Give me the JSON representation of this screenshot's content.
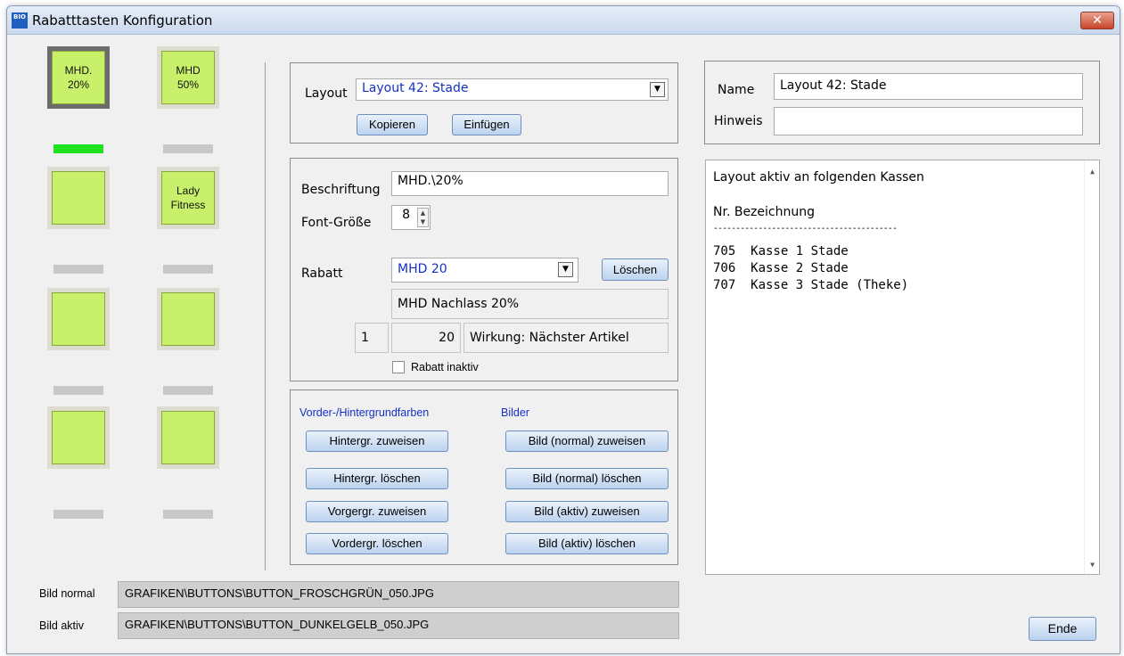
{
  "window": {
    "title": "Rabatttasten Konfiguration",
    "icon_text": "BIO",
    "close_label": "✕"
  },
  "keys": [
    {
      "label": "MHD.\n20%",
      "indicator_active": true,
      "selected": true
    },
    {
      "label": "MHD\n50%",
      "indicator_active": false,
      "selected": false
    },
    {
      "label": "",
      "indicator_active": false,
      "selected": false
    },
    {
      "label": "Lady\nFitness",
      "indicator_active": false,
      "selected": false
    },
    {
      "label": "",
      "indicator_active": false,
      "selected": false
    },
    {
      "label": "",
      "indicator_active": false,
      "selected": false
    },
    {
      "label": "",
      "indicator_active": false,
      "selected": false
    },
    {
      "label": "",
      "indicator_active": false,
      "selected": false
    }
  ],
  "layout_box": {
    "label": "Layout",
    "selected": "Layout 42: Stade",
    "copy_button": "Kopieren",
    "paste_button": "Einfügen"
  },
  "key_box": {
    "caption_label": "Beschriftung",
    "caption_value": "MHD.\\20%",
    "font_size_label": "Font-Größe",
    "font_size_value": "8",
    "discount_label": "Rabatt",
    "discount_selected": "MHD 20",
    "delete_button": "Löschen",
    "discount_description": "MHD Nachlass 20%",
    "discount_number": "1",
    "discount_percent": "20",
    "effect": "Wirkung: Nächster Artikel",
    "inactive_label": "Rabatt inaktiv",
    "inactive_checked": false
  },
  "colors_box": {
    "colors_heading": "Vorder-/Hintergrundfarben",
    "images_heading": "Bilder",
    "buttons_left": [
      "Hintergr. zuweisen",
      "Hintergr. löschen",
      "Vorgergr. zuweisen",
      "Vordergr. löschen"
    ],
    "buttons_right": [
      "Bild  (normal) zuweisen",
      "Bild (normal) löschen",
      "Bild (aktiv) zuweisen",
      "Bild  (aktiv) löschen"
    ]
  },
  "info_box": {
    "name_label": "Name",
    "name_value": "Layout 42: Stade",
    "note_label": "Hinweis",
    "note_value": ""
  },
  "registers": {
    "heading": "Layout aktiv an folgenden Kassen",
    "column_header": "Nr.  Bezeichnung",
    "divider": "-----------------------------------------",
    "rows": [
      "705  Kasse 1 Stade",
      "706  Kasse 2 Stade",
      "707  Kasse 3 Stade (Theke)"
    ]
  },
  "paths": {
    "normal_label": "Bild normal",
    "normal_value": "GRAFIKEN\\BUTTONS\\BUTTON_FROSCHGRÜN_050.JPG",
    "active_label": "Bild aktiv",
    "active_value": "GRAFIKEN\\BUTTONS\\BUTTON_DUNKELGELB_050.JPG"
  },
  "end_button": "Ende",
  "colors": {
    "key_green": "#c8f06a",
    "indicator_on": "#1ee21e",
    "accent_text": "#1530c8"
  }
}
